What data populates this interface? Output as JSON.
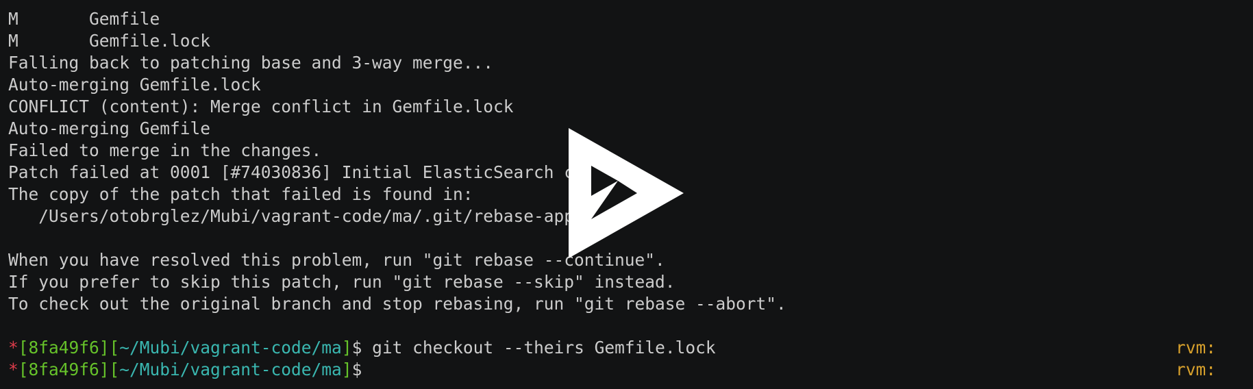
{
  "terminal": {
    "lines": [
      "M       Gemfile",
      "M       Gemfile.lock",
      "Falling back to patching base and 3-way merge...",
      "Auto-merging Gemfile.lock",
      "CONFLICT (content): Merge conflict in Gemfile.lock",
      "Auto-merging Gemfile",
      "Failed to merge in the changes.",
      "Patch failed at 0001 [#74030836] Initial ElasticSearch co",
      "The copy of the patch that failed is found in:",
      "   /Users/otobrglez/Mubi/vagrant-code/ma/.git/rebase-appl",
      "",
      "When you have resolved this problem, run \"git rebase --continue\".",
      "If you prefer to skip this patch, run \"git rebase --skip\" instead.",
      "To check out the original branch and stop rebasing, run \"git rebase --abort\".",
      ""
    ],
    "prompts": [
      {
        "star": "*",
        "commit": "[8fa49f6]",
        "path_open": "[",
        "path": "~/Mubi/vagrant-code/ma",
        "path_close": "]",
        "dollar": "$",
        "command": " git checkout --theirs Gemfile.lock",
        "rvm": "rvm:"
      },
      {
        "star": "*",
        "commit": "[8fa49f6]",
        "path_open": "[",
        "path": "~/Mubi/vagrant-code/ma",
        "path_close": "]",
        "dollar": "$",
        "command": "",
        "rvm": "rvm:"
      }
    ]
  },
  "player": {
    "icon": "asciinema-play-icon",
    "color": "#ffffff"
  },
  "colors": {
    "background": "#121314",
    "text": "#cccccc",
    "star": "#dd3c4b",
    "commit": "#66c22a",
    "path": "#3ab7b0",
    "rvm": "#d8a12c"
  }
}
